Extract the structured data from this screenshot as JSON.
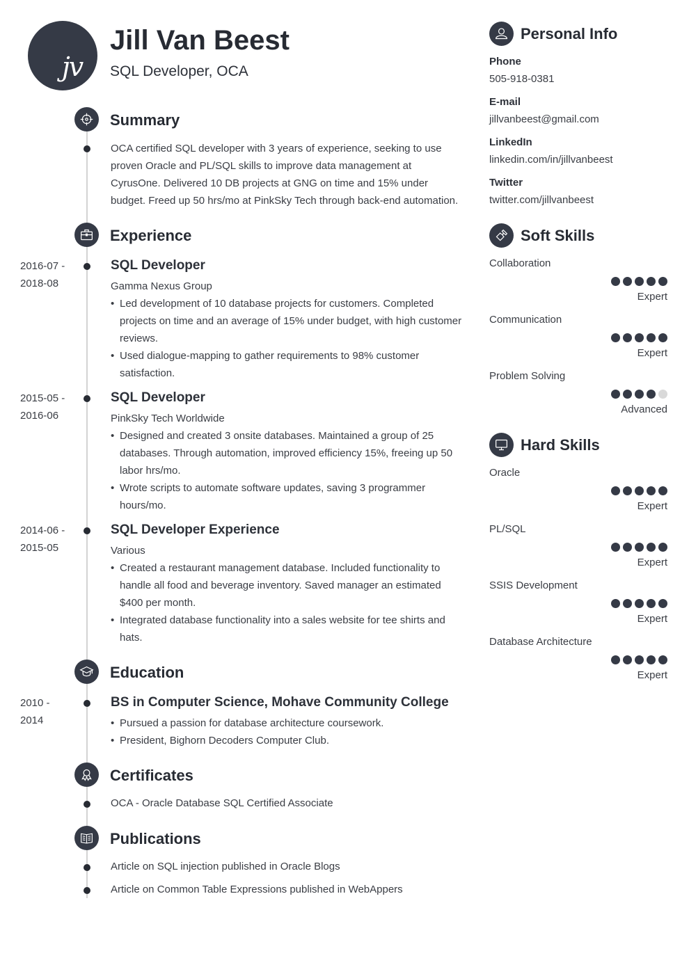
{
  "header": {
    "initials": "jv",
    "name": "Jill Van Beest",
    "title": "SQL Developer, OCA"
  },
  "summary": {
    "heading": "Summary",
    "icon": "target-icon",
    "text": "OCA certified SQL developer with 3 years of experience, seeking to use proven Oracle and PL/SQL skills to improve data management at CyrusOne. Delivered 10 DB projects at GNG on time and 15% under budget. Freed up 50 hrs/mo at PinkSky Tech through back-end automation."
  },
  "experience": {
    "heading": "Experience",
    "icon": "briefcase-icon",
    "items": [
      {
        "date": "2016-07 -\n2018-08",
        "title": "SQL Developer",
        "company": "Gamma Nexus Group",
        "bullets": [
          "Led development of 10 database projects for customers. Completed projects on time and an average of 15% under budget, with high customer reviews.",
          "Used dialogue-mapping to gather requirements to 98% customer satisfaction."
        ]
      },
      {
        "date": "2015-05 -\n2016-06",
        "title": "SQL Developer",
        "company": "PinkSky Tech Worldwide",
        "bullets": [
          "Designed and created 3 onsite databases. Maintained a group of 25 databases. Through automation, improved efficiency 15%, freeing up 50 labor hrs/mo.",
          "Wrote scripts to automate software updates, saving 3 programmer hours/mo."
        ]
      },
      {
        "date": "2014-06 -\n2015-05",
        "title": "SQL Developer Experience",
        "company": "Various",
        "bullets": [
          "Created a restaurant management database. Included functionality to handle all food and beverage inventory. Saved manager an estimated $400 per month.",
          "Integrated database functionality into a sales website for tee shirts and hats."
        ]
      }
    ]
  },
  "education": {
    "heading": "Education",
    "icon": "graduation-cap-icon",
    "items": [
      {
        "date": "2010 -\n2014",
        "title": "BS in Computer Science, Mohave Community College",
        "bullets": [
          "Pursued a passion for database architecture coursework.",
          "President, Bighorn Decoders Computer Club."
        ]
      }
    ]
  },
  "certificates": {
    "heading": "Certificates",
    "icon": "award-ribbon-icon",
    "items": [
      "OCA - Oracle Database SQL Certified Associate"
    ]
  },
  "publications": {
    "heading": "Publications",
    "icon": "open-book-icon",
    "items": [
      "Article on SQL injection published in Oracle Blogs",
      "Article on Common Table Expressions published in WebAppers"
    ]
  },
  "personal_info": {
    "heading": "Personal Info",
    "icon": "user-icon",
    "fields": [
      {
        "label": "Phone",
        "value": "505-918-0381"
      },
      {
        "label": "E-mail",
        "value": "jillvanbeest@gmail.com"
      },
      {
        "label": "LinkedIn",
        "value": "linkedin.com/in/jillvanbeest"
      },
      {
        "label": "Twitter",
        "value": "twitter.com/jillvanbeest"
      }
    ]
  },
  "soft_skills": {
    "heading": "Soft Skills",
    "icon": "puzzle-piece-icon",
    "items": [
      {
        "name": "Collaboration",
        "rating": 5,
        "max": 5,
        "level": "Expert"
      },
      {
        "name": "Communication",
        "rating": 5,
        "max": 5,
        "level": "Expert"
      },
      {
        "name": "Problem Solving",
        "rating": 4,
        "max": 5,
        "level": "Advanced"
      }
    ]
  },
  "hard_skills": {
    "heading": "Hard Skills",
    "icon": "monitor-icon",
    "items": [
      {
        "name": "Oracle",
        "rating": 5,
        "max": 5,
        "level": "Expert"
      },
      {
        "name": "PL/SQL",
        "rating": 5,
        "max": 5,
        "level": "Expert"
      },
      {
        "name": "SSIS Development",
        "rating": 5,
        "max": 5,
        "level": "Expert"
      },
      {
        "name": "Database Architecture",
        "rating": 5,
        "max": 5,
        "level": "Expert"
      }
    ]
  },
  "colors": {
    "accent": "#353a46",
    "heading": "#272b33",
    "text": "#3a3d44",
    "timeline": "#d3d3d3",
    "rating_off": "#d9d9d9"
  }
}
